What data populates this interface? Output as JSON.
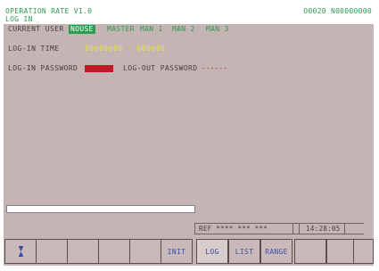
{
  "header": {
    "title_line1": "OPERATION RATE V1.0",
    "title_line2": "LOG IN",
    "counter": "O0020 N00000000"
  },
  "login": {
    "current_user_label": "CURRENT USER",
    "user_options": [
      "NOUSE",
      "MASTER",
      "MAN 1",
      "MAN 2",
      "MAN 3"
    ],
    "selected_user": "NOUSE",
    "login_time_label": "LOG-IN TIME",
    "login_time_value": "00000000 - 000000",
    "login_password_label": "LOG-IN PASSWORD",
    "logout_password_label": "LOG-OUT PASSWORD",
    "logout_password_value": "------"
  },
  "progress": {
    "fraction": 1.0
  },
  "status": {
    "ref": "REF  **** *** ***",
    "time": "14:28:05"
  },
  "softkeys": [
    "hourglass-icon",
    "",
    "",
    "",
    "",
    "INIT",
    "LOG",
    "LIST",
    "RANGE",
    "",
    "",
    ""
  ],
  "colors": {
    "screen_bg": "#c4b4b4",
    "title_green": "#2e9a52",
    "time_yellow": "#e8e24a",
    "password_red": "#c01a28",
    "softkey_text": "#3c4ea8"
  }
}
